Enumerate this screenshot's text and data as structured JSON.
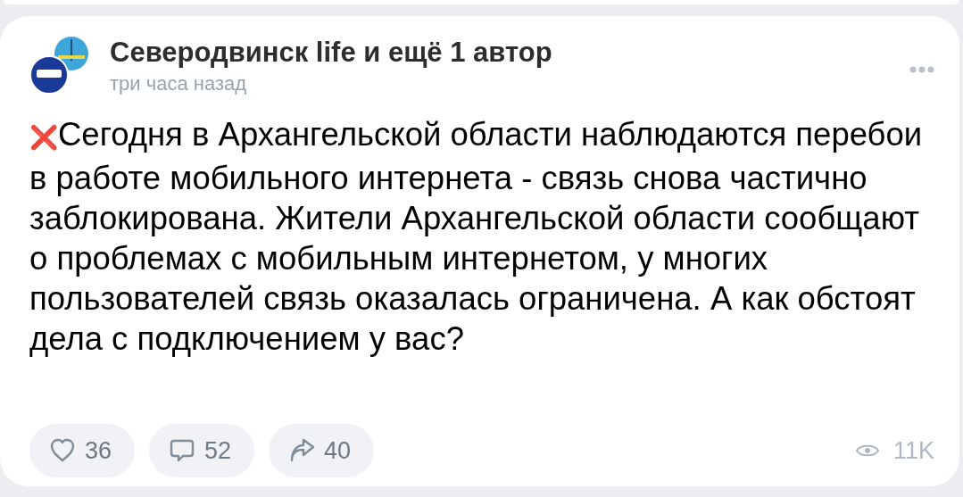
{
  "post": {
    "author": "Северодвинск life и ещё 1 автор",
    "time": "три часа назад",
    "text": "❌Сегодня в Архангельской области наблюдаются перебои в работе мобильного интернета - связь снова частично заблокирована. Жители Архангельской области сообщают о проблемах с мобильным интернетом, у многих пользователей связь оказалась ограничена. А как обстоят дела с подключением у вас?"
  },
  "actions": [
    {
      "kind": "like",
      "count": "36"
    },
    {
      "kind": "comment",
      "count": "52"
    },
    {
      "kind": "share",
      "count": "40"
    }
  ],
  "views": "11K"
}
